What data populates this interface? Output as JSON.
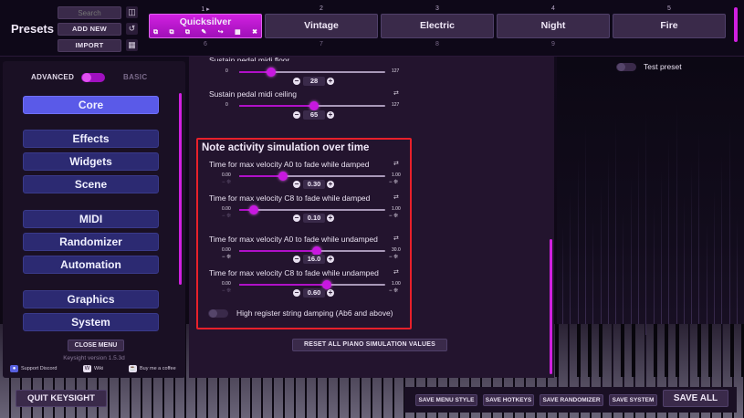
{
  "top": {
    "title": "Presets",
    "search_placeholder": "Search",
    "add_new": "ADD NEW",
    "import": "IMPORT",
    "slots": [
      {
        "num": "1",
        "label": "Quicksilver"
      },
      {
        "num": "2",
        "label": "Vintage"
      },
      {
        "num": "3",
        "label": "Electric"
      },
      {
        "num": "4",
        "label": "Night"
      },
      {
        "num": "5",
        "label": "Fire"
      }
    ],
    "slots_row2": [
      "6",
      "7",
      "8",
      "9"
    ]
  },
  "sidebar": {
    "mode_advanced": "ADVANCED",
    "mode_basic": "BASIC",
    "items": [
      "Core",
      "Effects",
      "Widgets",
      "Scene",
      "MIDI",
      "Randomizer",
      "Automation",
      "Graphics",
      "System"
    ],
    "close_menu": "CLOSE MENU",
    "version": "Keysight version 1.5.3d",
    "support": "Support Discord",
    "wiki": "Wiki",
    "coffee": "Buy me a coffee"
  },
  "main": {
    "partial_label": "Sustain pedal midi floor",
    "floor": {
      "min": "0",
      "max": "127",
      "value": "28"
    },
    "ceiling": {
      "label": "Sustain pedal midi ceiling",
      "min": "0",
      "max": "127",
      "value": "65"
    },
    "section_title": "Note activity simulation over time",
    "params": [
      {
        "label": "Time for max velocity A0 to fade while damped",
        "min": "0.00",
        "max": "1.00",
        "value": "0.30"
      },
      {
        "label": "Time for max velocity C8 to fade while damped",
        "min": "0.00",
        "max": "1.00",
        "value": "0.10"
      },
      {
        "label": "Time for max velocity A0 to fade while undamped",
        "min": "0.00",
        "max": "30.0",
        "value": "16.0"
      },
      {
        "label": "Time for max velocity C8 to fade while undamped",
        "min": "0.00",
        "max": "1.00",
        "value": "0.60"
      }
    ],
    "toggle_label": "High register string damping (Ab6 and above)",
    "reset_all": "RESET ALL PIANO SIMULATION VALUES"
  },
  "right": {
    "test_preset": "Test preset"
  },
  "bottom": {
    "quit": "QUIT KEYSIGHT",
    "save_menu_style": "SAVE MENU STYLE",
    "save_hotkeys": "SAVE HOTKEYS",
    "save_randomizer": "SAVE RANDOMIZER",
    "save_system": "SAVE SYSTEM",
    "save_all": "SAVE ALL"
  },
  "colors": {
    "accent": "#c818e0",
    "nav": "#2c2a72",
    "nav_active": "#5a5ae8",
    "highlight_box": "#e8202a"
  }
}
